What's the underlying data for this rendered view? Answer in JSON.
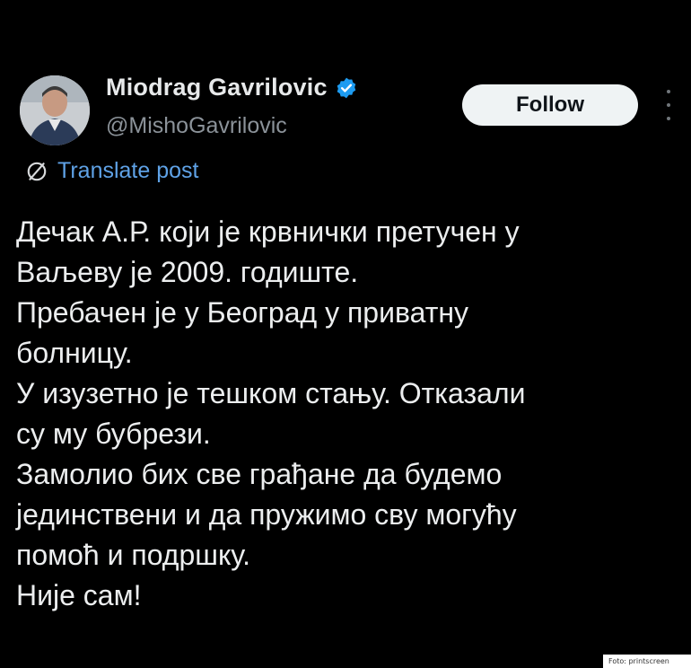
{
  "author": {
    "display_name": "Miodrag Gavrilovic",
    "handle": "@MishoGavrilovic",
    "verified": true,
    "avatar_icon": "profile-photo"
  },
  "actions": {
    "follow_label": "Follow",
    "more_icon": "vertical-ellipsis-icon"
  },
  "translate": {
    "icon": "translate-globe-icon",
    "label": "Translate post"
  },
  "post_lines": [
    "Дечак А.Р. који је крвнички претучен у",
    "Ваљеву је 2009. годиште.",
    "Пребачен је у Београд у приватну",
    "болницу.",
    "У изузетно је тешком стању. Отказали",
    "су му бубрези.",
    "Замолио бих све грађане да будемо",
    "јединствени и да пружимо сву могућу",
    "помоћ и подршку.",
    "Није сам!"
  ],
  "watermark": {
    "text": "Foto: printscreen"
  },
  "colors": {
    "background": "#000000",
    "text_primary": "#e7e9ea",
    "text_secondary": "#8b9299",
    "link": "#5fa2e6",
    "verified_badge": "#1d9bf0",
    "follow_bg": "#eff3f4"
  }
}
